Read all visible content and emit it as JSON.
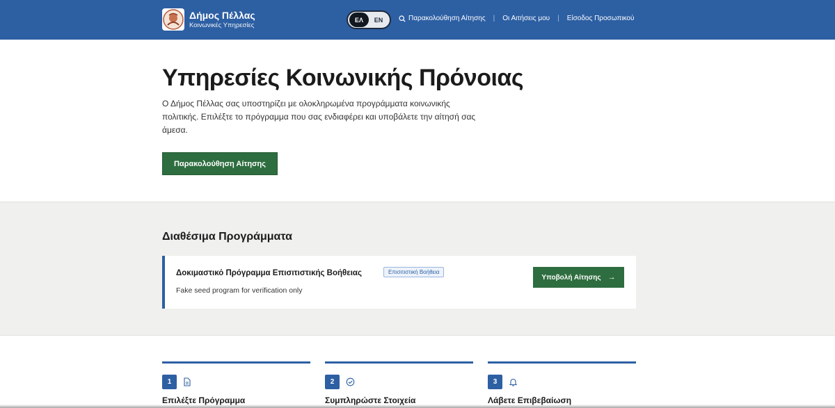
{
  "header": {
    "brand_title": "Δήμος Πέλλας",
    "brand_subtitle": "Κοινωνικές Υπηρεσίες",
    "lang_el": "ΕΛ",
    "lang_en": "EN",
    "active_lang": "ΕΛ",
    "nav": {
      "track": "Παρακολούθηση Αίτησης",
      "my_applications": "Οι Αιτήσεις μου",
      "staff_login": "Είσοδος Προσωπικού"
    }
  },
  "hero": {
    "title": "Υπηρεσίες Κοινωνικής Πρόνοιας",
    "description": "Ο Δήμος Πέλλας σας υποστηρίζει με ολοκληρωμένα προγράμματα κοινωνικής πολιτικής. Επιλέξτε το πρόγραμμα που σας ενδιαφέρει και υποβάλετε την αίτησή σας άμεσα.",
    "button": "Παρακολούθηση Αίτησης"
  },
  "programs": {
    "title": "Διαθέσιμα Προγράμματα",
    "items": [
      {
        "name": "Δοκιμαστικό Πρόγραμμα Επισιτιστικής Βοήθειας",
        "badge": "Επισιτιστική Βοήθεια",
        "description": "Fake seed program for verification only",
        "button": "Υποβολή Αίτησης"
      }
    ]
  },
  "steps": [
    {
      "number": "1",
      "title": "Επιλέξτε Πρόγραμμα",
      "icon": "document-icon"
    },
    {
      "number": "2",
      "title": "Συμπληρώστε Στοιχεία",
      "icon": "check-circle-icon"
    },
    {
      "number": "3",
      "title": "Λάβετε Επιβεβαίωση",
      "icon": "bell-icon"
    }
  ],
  "colors": {
    "primary_blue": "#2d5fa3",
    "action_green": "#2e6d3f",
    "section_gray": "#f0f0ee"
  }
}
